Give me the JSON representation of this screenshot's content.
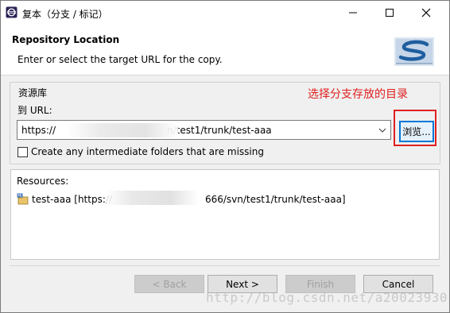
{
  "window": {
    "title": "复本（分支 / 标记）"
  },
  "header": {
    "title": "Repository Location",
    "description": "Enter or select the target URL for the copy."
  },
  "repository": {
    "group_label": "资源库",
    "url_label": "到 URL:",
    "url_value_prefix": "https://",
    "url_value_suffix": "n/test1/trunk/test-aaa",
    "browse_label": "浏览...",
    "create_folders_label": "Create any intermediate folders that are missing",
    "create_folders_checked": false
  },
  "annotation": {
    "text": "选择分支存放的目录",
    "color": "#e02020"
  },
  "resources": {
    "title": "Resources:",
    "items": [
      {
        "name": "test-aaa",
        "url_prefix": "[https://",
        "url_suffix": "666/svn/test1/trunk/test-aaa]"
      }
    ]
  },
  "buttons": {
    "back": "< Back",
    "next": "Next >",
    "finish": "Finish",
    "cancel": "Cancel"
  },
  "watermark": "http://blog.csdn.net/a20023930",
  "colors": {
    "accent": "#0078d7",
    "highlight_red": "#e02020"
  }
}
